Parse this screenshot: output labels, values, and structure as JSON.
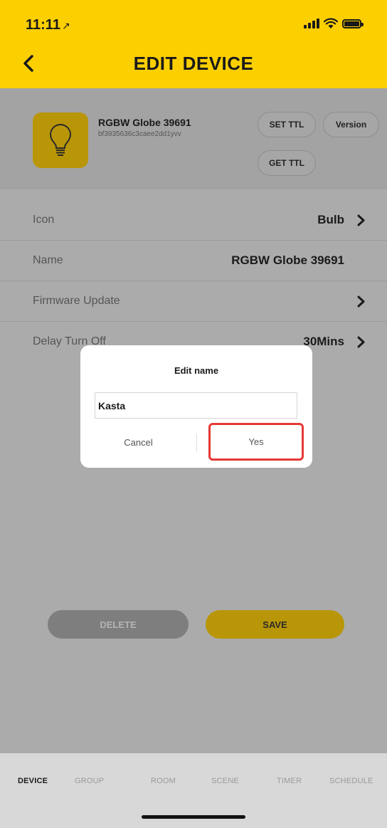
{
  "status_bar": {
    "time": "11:11",
    "location_glyph": "↗"
  },
  "header": {
    "title": "EDIT DEVICE",
    "back_icon": "chevron-left-icon"
  },
  "device": {
    "name": "RGBW Globe 39691",
    "id": "bf3935636c3caee2dd1yvv",
    "icon": "bulb-icon",
    "buttons": {
      "set_ttl": "SET TTL",
      "version": "Version",
      "get_ttl": "GET TTL"
    }
  },
  "settings": [
    {
      "label": "Icon",
      "value": "Bulb",
      "chevron": true
    },
    {
      "label": "Name",
      "value": "RGBW Globe 39691",
      "chevron": false
    },
    {
      "label": "Firmware Update",
      "value": "",
      "chevron": true
    },
    {
      "label": "Delay Turn Off",
      "value": "30Mins",
      "chevron": true
    }
  ],
  "actions": {
    "delete": "DELETE",
    "save": "SAVE"
  },
  "tabs": [
    "DEVICE",
    "GROUP",
    "ROOM",
    "SCENE",
    "TIMER",
    "SCHEDULE"
  ],
  "active_tab": "DEVICE",
  "dialog": {
    "title": "Edit name",
    "input_value": "Kasta",
    "cancel": "Cancel",
    "confirm": "Yes"
  },
  "colors": {
    "accent": "#fccf00",
    "accent_dimmed": "#b99607",
    "highlight_box": "#e53935"
  }
}
